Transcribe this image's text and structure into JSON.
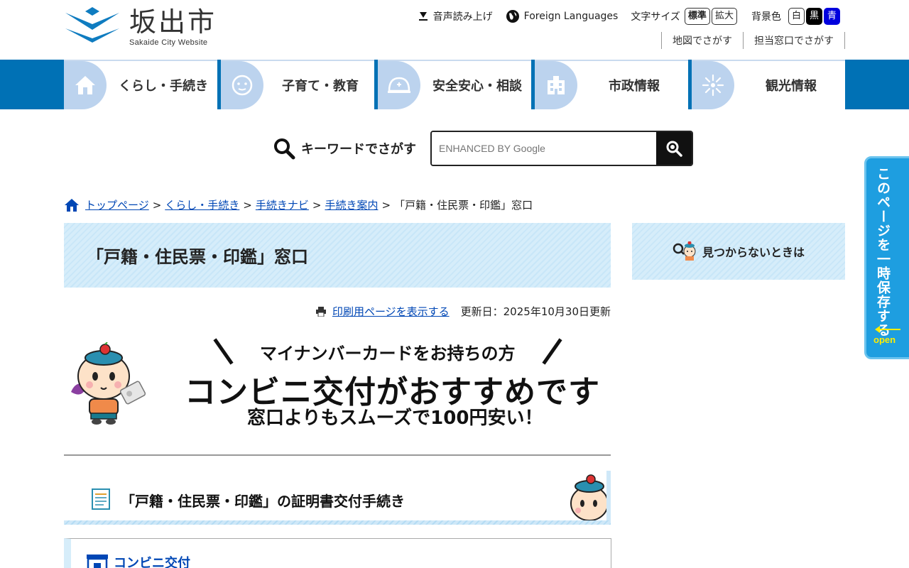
{
  "header": {
    "logo_title": "坂出市",
    "logo_sub": "Sakaide City Website",
    "util": {
      "voice": "音声読み上げ",
      "foreign": "Foreign Languages",
      "font_size_label": "文字サイズ",
      "font_standard": "標準",
      "font_large": "拡大",
      "bg_label": "背景色",
      "bg_white": "白",
      "bg_black": "黒",
      "bg_blue": "青"
    },
    "sublinks": [
      "地図でさがす",
      "担当窓口でさがす"
    ]
  },
  "gnav": [
    {
      "label": "くらし・手続き",
      "icon": "house-icon"
    },
    {
      "label": "子育て・教育",
      "icon": "baby-icon"
    },
    {
      "label": "安全安心・相談",
      "icon": "helmet-icon"
    },
    {
      "label": "市政情報",
      "icon": "building-icon"
    },
    {
      "label": "観光情報",
      "icon": "firework-icon"
    }
  ],
  "search": {
    "label": "キーワードでさがす",
    "placeholder": "ENHANCED BY Google"
  },
  "breadcrumb": {
    "items": [
      "トップページ",
      "くらし・手続き",
      "手続きナビ",
      "手続き案内"
    ],
    "current": "「戸籍・住民票・印鑑」窓口",
    "sep": ">"
  },
  "page": {
    "title": "「戸籍・住民票・印鑑」窓口",
    "print_link": "印刷用ページを表示する",
    "updated": "更新日：2025年10月30日更新"
  },
  "side": {
    "not_found": "見つからないときは"
  },
  "banner": {
    "line1": "マイナンバーカードをお持ちの方",
    "line2": "コンビニ交付がおすすめです",
    "line3": "窓口よりもスムーズで100円安い！"
  },
  "section": {
    "heading": "「戸籍・住民票・印鑑」の証明書交付手続き",
    "sub": "コンビニ交付"
  },
  "float_tab": {
    "text": "このページを一時保存する",
    "open": "open"
  }
}
